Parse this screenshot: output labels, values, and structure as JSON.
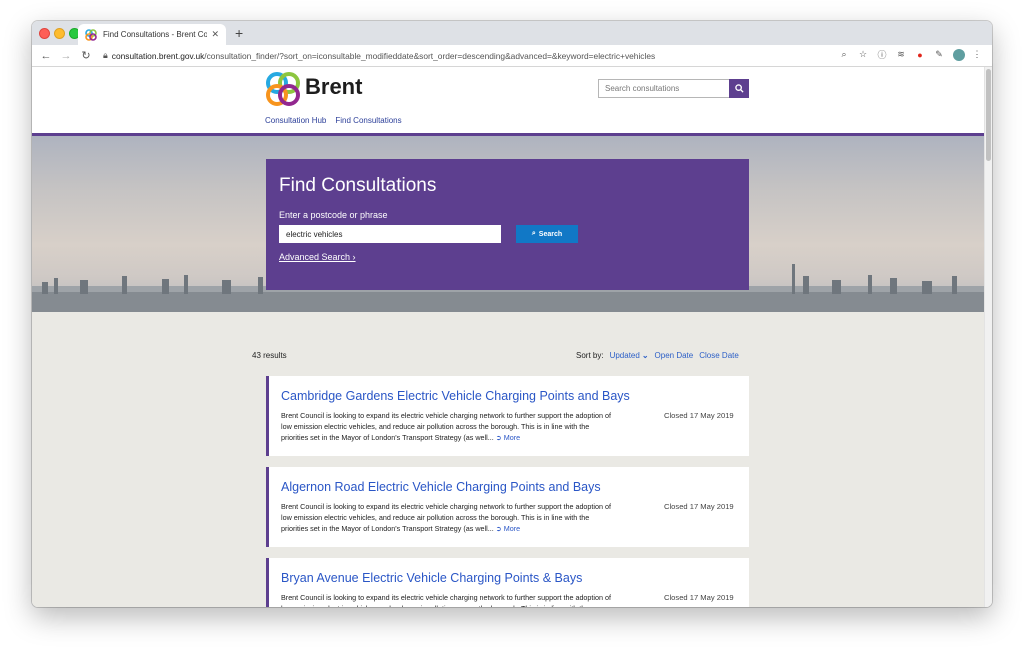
{
  "browser": {
    "tab_title": "Find Consultations - Brent Cou",
    "tab_close": "✕",
    "new_tab": "+",
    "url_host": "consultation.brent.gov.uk",
    "url_path": "/consultation_finder/?sort_on=iconsultable_modifieddate&sort_order=descending&advanced=&keyword=electric+vehicles"
  },
  "site": {
    "brand": "Brent",
    "search_placeholder": "Search consultations",
    "nav": [
      "Consultation Hub",
      "Find Consultations"
    ]
  },
  "hero": {
    "title": "Find Consultations",
    "label": "Enter a postcode or phrase",
    "input_value": "electric vehicles",
    "search_button": "Search",
    "advanced_link": "Advanced Search ›"
  },
  "results": {
    "count": "43 results",
    "sort_label": "Sort by:",
    "sort_options": [
      "Updated",
      "Open Date",
      "Close Date"
    ],
    "more_label": "More",
    "items": [
      {
        "title": "Cambridge Gardens Electric Vehicle Charging Points and Bays",
        "description": "Brent Council is looking to expand its electric vehicle charging network to further support the adoption of low emission electric vehicles, and reduce air pollution across the borough. This is in line with the priorities set in the Mayor of London's Transport Strategy (as well...",
        "status": "Closed 17 May 2019"
      },
      {
        "title": "Algernon Road Electric Vehicle Charging Points and Bays",
        "description": "Brent Council is looking to expand its electric vehicle charging network to further support the adoption of low emission electric vehicles, and reduce air pollution across the borough. This is in line with the priorities set in the Mayor of London's Transport Strategy (as well...",
        "status": "Closed 17 May 2019"
      },
      {
        "title": "Bryan Avenue Electric Vehicle Charging Points & Bays",
        "description": "Brent Council is looking to expand its electric vehicle charging network to further support the adoption of low emission electric vehicles, and reduce air pollution across the borough. This is in line with the priorities set in the Mayor of London's Transport Strategy (as well...",
        "status": "Closed 17 May 2019"
      }
    ]
  },
  "colors": {
    "brand_purple": "#5d3f8f",
    "link_blue": "#2a56c6",
    "search_blue": "#1178c6"
  },
  "icons": [
    "search-icon",
    "back-icon",
    "forward-icon",
    "reload-icon",
    "lock-icon",
    "zoom-icon",
    "star-icon",
    "info-icon",
    "layers-icon",
    "opera-icon",
    "extension-icon",
    "profile-avatar",
    "menu-icon",
    "chevron-down-icon",
    "arrow-circle-icon"
  ]
}
